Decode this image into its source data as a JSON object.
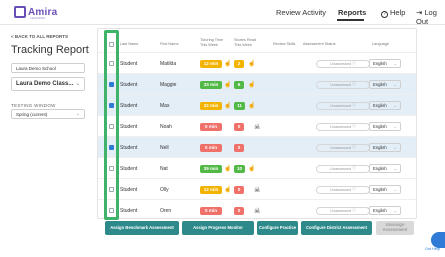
{
  "header": {
    "logo_text": "Amira",
    "logo_sub": "LEARNING",
    "nav": [
      {
        "label": "Review Activity"
      },
      {
        "label": "Reports"
      },
      {
        "label": "Help"
      },
      {
        "label": "Log Out"
      }
    ]
  },
  "left_panel": {
    "back_label": "< BACK TO ALL REPORTS",
    "title": "Tracking Report",
    "school": "Laura Demo School",
    "class": "Laura Demo Class...",
    "window_label": "TESTING WINDOW",
    "window_value": "Spring (current)"
  },
  "table": {
    "headers": {
      "last_name": "Last Name",
      "first_name": "First Name",
      "tutoring": "Tutoring Time This Week",
      "stories": "Stories Read This Week",
      "skills": "Review Skills",
      "assessment": "Assessment Status",
      "language": "Language"
    },
    "rows": [
      {
        "last": "Student",
        "first": "Matilda",
        "selected": false,
        "minutes": "12 min",
        "min_color": "#f2b400",
        "stories": "2",
        "st_color": "#f2b400",
        "hand1": true,
        "hand2": true,
        "bug": false,
        "status": "Unassessed",
        "lang": "English"
      },
      {
        "last": "Student",
        "first": "Maggie",
        "selected": true,
        "minutes": "33 min",
        "min_color": "#52b947",
        "stories": "6",
        "st_color": "#52b947",
        "hand1": true,
        "hand2": true,
        "bug": false,
        "status": "Unassessed",
        "lang": "English"
      },
      {
        "last": "Student",
        "first": "Max",
        "selected": true,
        "minutes": "22 min",
        "min_color": "#f2b400",
        "stories": "11",
        "st_color": "#52b947",
        "hand1": true,
        "hand2": true,
        "bug": false,
        "status": "Unassessed",
        "lang": "English"
      },
      {
        "last": "Student",
        "first": "Noah",
        "selected": false,
        "minutes": "0 min",
        "min_color": "#f0706a",
        "stories": "0",
        "st_color": "#f0706a",
        "hand1": false,
        "hand2": false,
        "bug": true,
        "status": "Unassessed",
        "lang": "English"
      },
      {
        "last": "Student",
        "first": "Nell",
        "selected": true,
        "minutes": "0 min",
        "min_color": "#f0706a",
        "stories": "0",
        "st_color": "#f0706a",
        "hand1": false,
        "hand2": false,
        "bug": false,
        "status": "Unassessed",
        "lang": "English"
      },
      {
        "last": "Student",
        "first": "Nat",
        "selected": false,
        "minutes": "39 min",
        "min_color": "#52b947",
        "stories": "10",
        "st_color": "#52b947",
        "hand1": true,
        "hand2": true,
        "bug": false,
        "status": "Unassessed",
        "lang": "English"
      },
      {
        "last": "Student",
        "first": "Olly",
        "selected": false,
        "minutes": "12 min",
        "min_color": "#f2b400",
        "stories": "0",
        "st_color": "#f0706a",
        "hand1": true,
        "hand2": false,
        "bug": true,
        "status": "Unassessed",
        "lang": "English"
      },
      {
        "last": "Student",
        "first": "Oren",
        "selected": false,
        "minutes": "0 min",
        "min_color": "#f0706a",
        "stories": "0",
        "st_color": "#f0706a",
        "hand1": false,
        "hand2": false,
        "bug": true,
        "status": "Unassessed",
        "lang": "English"
      },
      {
        "last": "Student",
        "first": "Oryl",
        "selected": false,
        "minutes": "",
        "min_color": "#f0706a",
        "stories": "",
        "st_color": "#f0706a",
        "hand1": false,
        "hand2": false,
        "bug": false,
        "status": "Unassessed",
        "lang": "English"
      }
    ]
  },
  "buttons": {
    "assign_benchmark": "Assign Benchmark Assessment",
    "assign_progress": "Assign Progress Monitor",
    "configure_practice": "Configure Practice",
    "configure_district": "Configure District Assessment",
    "unassign": "Unassign Assessment"
  },
  "chat_label": "Get Help"
}
